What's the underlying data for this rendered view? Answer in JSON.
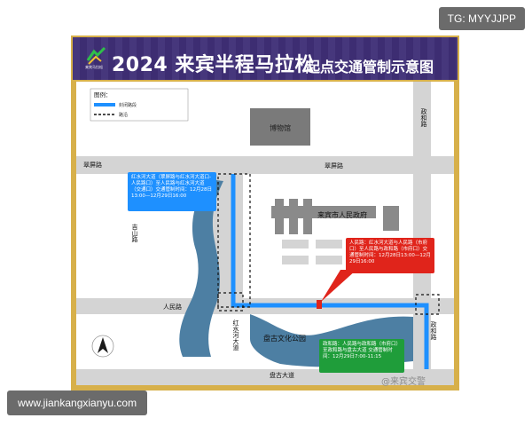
{
  "watermarks": {
    "top_right": "TG: MYYJJPP",
    "bottom_left": "www.jiankangxianyu.com",
    "weibo": "@来宾交警"
  },
  "header": {
    "logo_text": "来宾马拉松",
    "title": "2024 来宾半程马拉松",
    "subtitle": "起点交通管制示意图"
  },
  "legend": {
    "title": "图例：",
    "items": [
      {
        "label": "封闭路段",
        "color": "#1e90ff",
        "style": "solid"
      },
      {
        "label": "路沿",
        "color": "#111111",
        "style": "dashed"
      }
    ]
  },
  "roads": {
    "cuiping_left": "翠屏路",
    "cuiping_right": "翠屏路",
    "jiqing": "吉山路",
    "zhenghe_top": "政和路",
    "zhenghe_bottom": "政和路",
    "renmin": "人民路",
    "hongshuihe": "红水河大道",
    "pangu": "盘古大道"
  },
  "landmarks": {
    "museum": "博物馆",
    "gov": "来宾市人民政府",
    "park": "盘古文化公园"
  },
  "callouts": {
    "blue": {
      "text": "红水河大道（翠屏路与红水河大道口-人民路口）至人民路与红水河大道（交通口）交通管制时间：12月28日13:00—12月29日16:00",
      "color": "#1e90ff"
    },
    "red": {
      "text": "人民路：红水河大道与人民路（市府口）至人民路与政和路（市府口）交通管制时间：12月28日13:00—12月29日16:00",
      "color": "#e0241b"
    },
    "green": {
      "text": "政和路：人民路与政和路（市府口）至政和路与盘古大道 交通管制时间：12月29日7:00-11:15",
      "color": "#1f9d3a"
    }
  },
  "colors": {
    "closed_route": "#1e90ff",
    "river": "#4d7fa3",
    "block": "#ffffff",
    "building": "#7a7a7a",
    "banner": "#3f2f77",
    "frame": "#d7b04a"
  },
  "compass": {
    "label": "north-arrow-icon"
  }
}
